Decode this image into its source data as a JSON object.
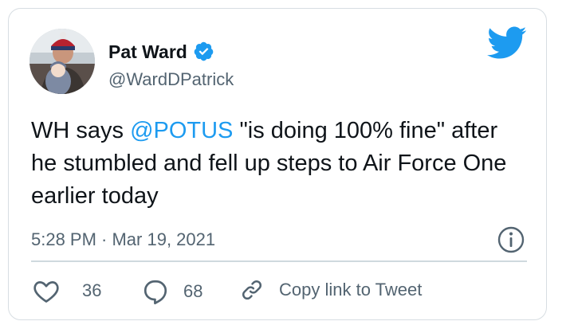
{
  "author": {
    "name": "Pat Ward",
    "handle": "@WardDPatrick"
  },
  "tweet": {
    "text_before": "WH says ",
    "mention": "@POTUS",
    "text_after": " \"is doing 100% fine\" after he stumbled and fell up steps to Air Force One earlier today",
    "timestamp": "5:28 PM · Mar 19, 2021"
  },
  "actions": {
    "likes_count": "36",
    "replies_count": "68",
    "copy_link_label": "Copy link to Tweet"
  },
  "colors": {
    "accent": "#1d9bf0",
    "text_primary": "#0f1419",
    "text_secondary": "#536471",
    "border": "#d7dde2"
  },
  "icons": [
    "verified-badge-icon",
    "twitter-bird-icon",
    "info-icon",
    "heart-icon",
    "reply-bubble-icon",
    "link-icon"
  ]
}
